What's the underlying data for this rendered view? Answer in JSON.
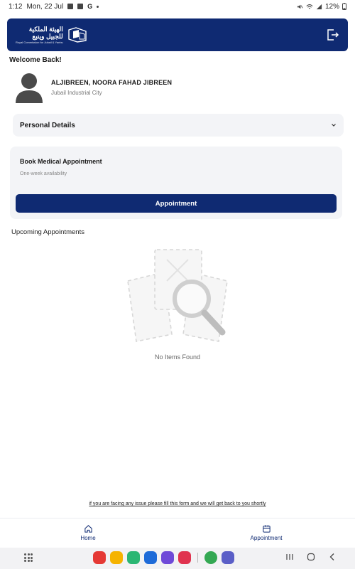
{
  "status_bar": {
    "time": "1:12",
    "date": "Mon, 22 Jul",
    "battery": "12%"
  },
  "header": {
    "logo_ar_line1": "الهيئة الملكية",
    "logo_ar_line2": "للجبيل وينبع",
    "logo_en": "Royal Commission for Jubail & Yanbu",
    "logout_icon": "logout-icon",
    "brand_color": "#0f2a72"
  },
  "welcome": "Welcome Back!",
  "profile": {
    "name": "ALJIBREEN, NOORA FAHAD JIBREEN",
    "city": "Jubail Industrial City"
  },
  "personal_details": {
    "label": "Personal Details"
  },
  "book_card": {
    "title": "Book Medical Appointment",
    "subtitle": "One-week availability",
    "button_label": "Appointment"
  },
  "upcoming": {
    "title": "Upcoming Appointments",
    "empty_text": "No Items Found"
  },
  "issue_link": "if you are facing any issue please fill this form and we will get back to you shortly",
  "bottom_nav": {
    "items": [
      {
        "label": "Home",
        "icon": "home-icon"
      },
      {
        "label": "Appointment",
        "icon": "calendar-icon"
      }
    ]
  },
  "system_dock": {
    "apps": [
      {
        "name": "flipboard-red",
        "color": "#e53935"
      },
      {
        "name": "notes-yellow",
        "color": "#f5b301"
      },
      {
        "name": "phone-green",
        "color": "#2bb673"
      },
      {
        "name": "messages-blue",
        "color": "#1e6bd8"
      },
      {
        "name": "internet-purple",
        "color": "#6f4ad8"
      },
      {
        "name": "screen-recorder",
        "color": "#e0334f"
      },
      {
        "name": "chrome",
        "color": "#34a853"
      },
      {
        "name": "teams",
        "color": "#5b5fc7"
      }
    ]
  }
}
